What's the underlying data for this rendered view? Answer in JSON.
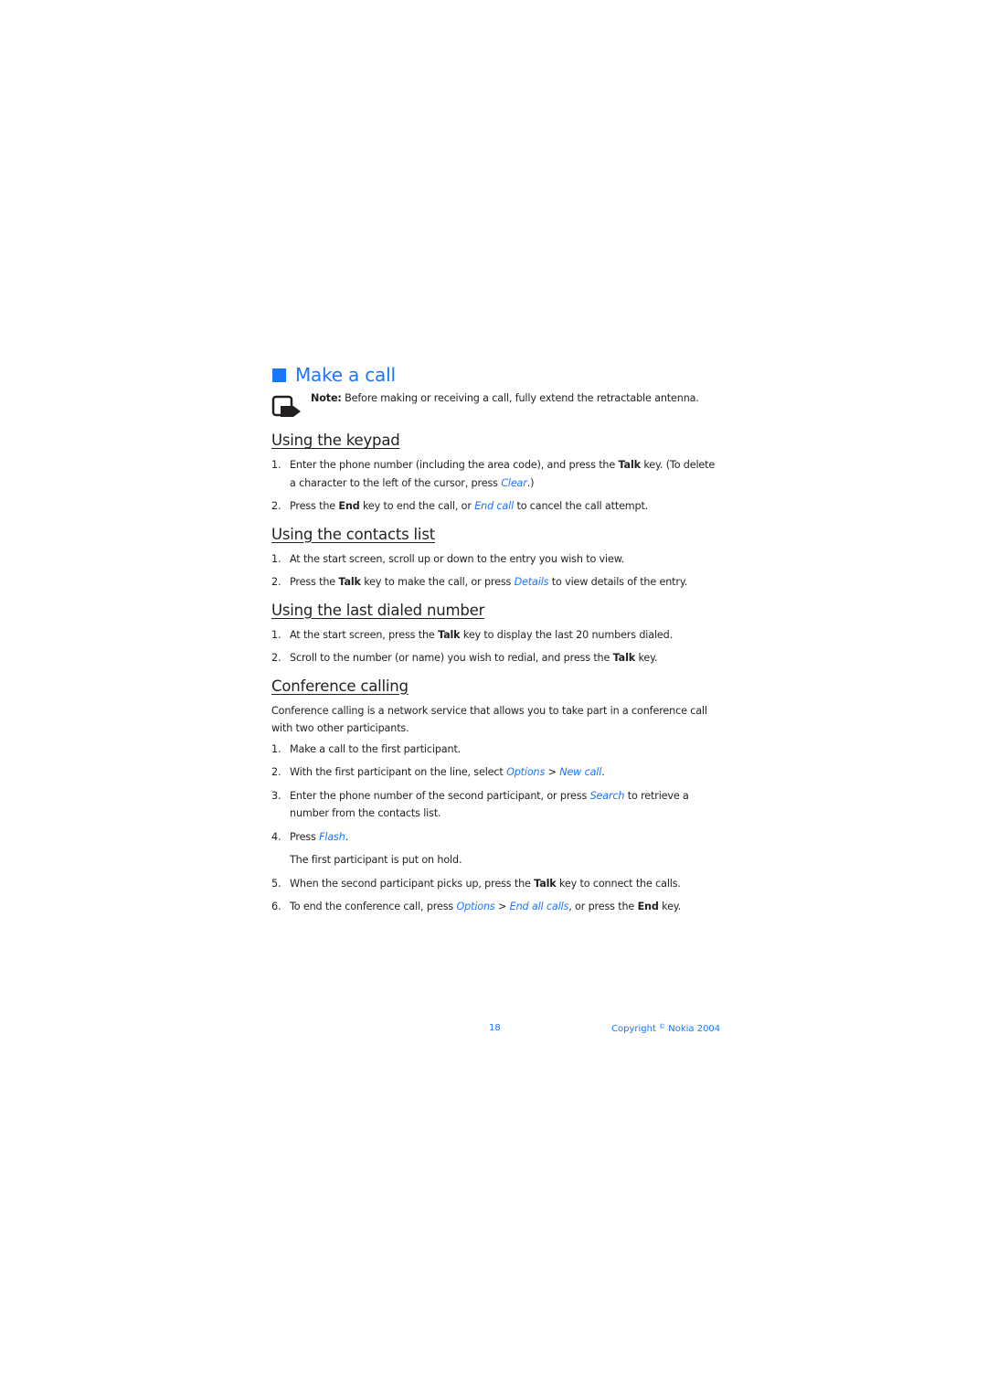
{
  "document": {
    "title": "Make a call",
    "note": {
      "label": "Note:",
      "text": " Before making or receiving a call, fully extend the retractable antenna."
    },
    "sections": [
      {
        "heading": "Using the keypad",
        "items": [
          {
            "num": "1.",
            "parts": [
              {
                "t": "Enter the phone number (including the area code), and press the "
              },
              {
                "t": "Talk",
                "style": "b"
              },
              {
                "t": " key. (To delete a character to the left of the cursor, press "
              },
              {
                "t": "Clear",
                "style": "link"
              },
              {
                "t": ".)"
              }
            ]
          },
          {
            "num": "2.",
            "parts": [
              {
                "t": "Press the "
              },
              {
                "t": "End",
                "style": "b"
              },
              {
                "t": " key to end the call, or "
              },
              {
                "t": "End call",
                "style": "link"
              },
              {
                "t": " to cancel the call attempt."
              }
            ]
          }
        ]
      },
      {
        "heading": "Using the contacts list",
        "items": [
          {
            "num": "1.",
            "parts": [
              {
                "t": "At the start screen, scroll up or down to the entry you wish to view."
              }
            ]
          },
          {
            "num": "2.",
            "parts": [
              {
                "t": "Press the "
              },
              {
                "t": "Talk",
                "style": "b"
              },
              {
                "t": " key to make the call, or press "
              },
              {
                "t": "Details",
                "style": "link"
              },
              {
                "t": " to view details of the entry."
              }
            ]
          }
        ]
      },
      {
        "heading": "Using the last dialed number",
        "items": [
          {
            "num": "1.",
            "parts": [
              {
                "t": "At the start screen, press the "
              },
              {
                "t": "Talk",
                "style": "b"
              },
              {
                "t": " key to display the last 20 numbers dialed."
              }
            ]
          },
          {
            "num": "2.",
            "parts": [
              {
                "t": "Scroll to the number (or name) you wish to redial, and press the "
              },
              {
                "t": "Talk",
                "style": "b"
              },
              {
                "t": " key."
              }
            ]
          }
        ]
      },
      {
        "heading": "Conference calling",
        "intro": "Conference calling is a network service that allows you to take part in a conference call with two other participants.",
        "items": [
          {
            "num": "1.",
            "parts": [
              {
                "t": "Make a call to the first participant."
              }
            ]
          },
          {
            "num": "2.",
            "parts": [
              {
                "t": "With the first participant on the line, select "
              },
              {
                "t": "Options",
                "style": "link"
              },
              {
                "t": " > "
              },
              {
                "t": "New call",
                "style": "link"
              },
              {
                "t": "."
              }
            ]
          },
          {
            "num": "3.",
            "parts": [
              {
                "t": "Enter the phone number of the second participant, or press "
              },
              {
                "t": "Search",
                "style": "link"
              },
              {
                "t": " to retrieve a number from the contacts list."
              }
            ]
          },
          {
            "num": "4.",
            "parts": [
              {
                "t": "Press "
              },
              {
                "t": "Flash",
                "style": "link"
              },
              {
                "t": "."
              }
            ],
            "sub": "The first participant is put on hold."
          },
          {
            "num": "5.",
            "parts": [
              {
                "t": "When the second participant picks up, press the "
              },
              {
                "t": "Talk",
                "style": "b"
              },
              {
                "t": " key to connect the calls."
              }
            ]
          },
          {
            "num": "6.",
            "parts": [
              {
                "t": "To end the conference call, press "
              },
              {
                "t": "Options",
                "style": "link"
              },
              {
                "t": " > "
              },
              {
                "t": "End all calls",
                "style": "link"
              },
              {
                "t": ", or press the "
              },
              {
                "t": "End",
                "style": "b"
              },
              {
                "t": " key."
              }
            ]
          }
        ]
      }
    ]
  },
  "footer": {
    "page_number": "18",
    "copyright_prefix": "Copyright ",
    "copyright_symbol": "©",
    "copyright_suffix": " Nokia 2004"
  },
  "colors": {
    "accent": "#1a75ff",
    "text": "#231f20"
  }
}
